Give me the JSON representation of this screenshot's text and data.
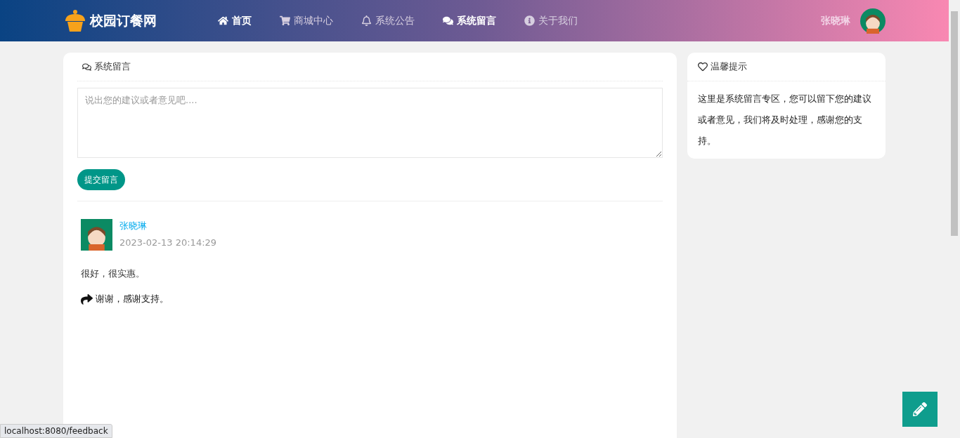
{
  "header": {
    "logo": "校园订餐网",
    "nav": [
      {
        "label": "首页",
        "selected": true
      },
      {
        "label": "商城中心",
        "selected": false
      },
      {
        "label": "系统公告",
        "selected": false
      },
      {
        "label": "系统留言",
        "selected": true
      },
      {
        "label": "关于我们",
        "selected": false
      }
    ],
    "user": "张晓琳"
  },
  "feedback": {
    "title": "系统留言",
    "placeholder": "说出您的建议或者意见吧....",
    "submit": "提交留言",
    "messages": [
      {
        "author": "张晓琳",
        "time": "2023-02-13 20:14:29",
        "content": "很好，很实惠。",
        "reply": "谢谢，感谢支持。"
      }
    ]
  },
  "tips": {
    "title": "温馨提示",
    "body": "这里是系统留言专区，您可以留下您的建议或者意见，我们将及时处理，感谢您的支持。"
  },
  "status_bar": "localhost:8080/feedback"
}
